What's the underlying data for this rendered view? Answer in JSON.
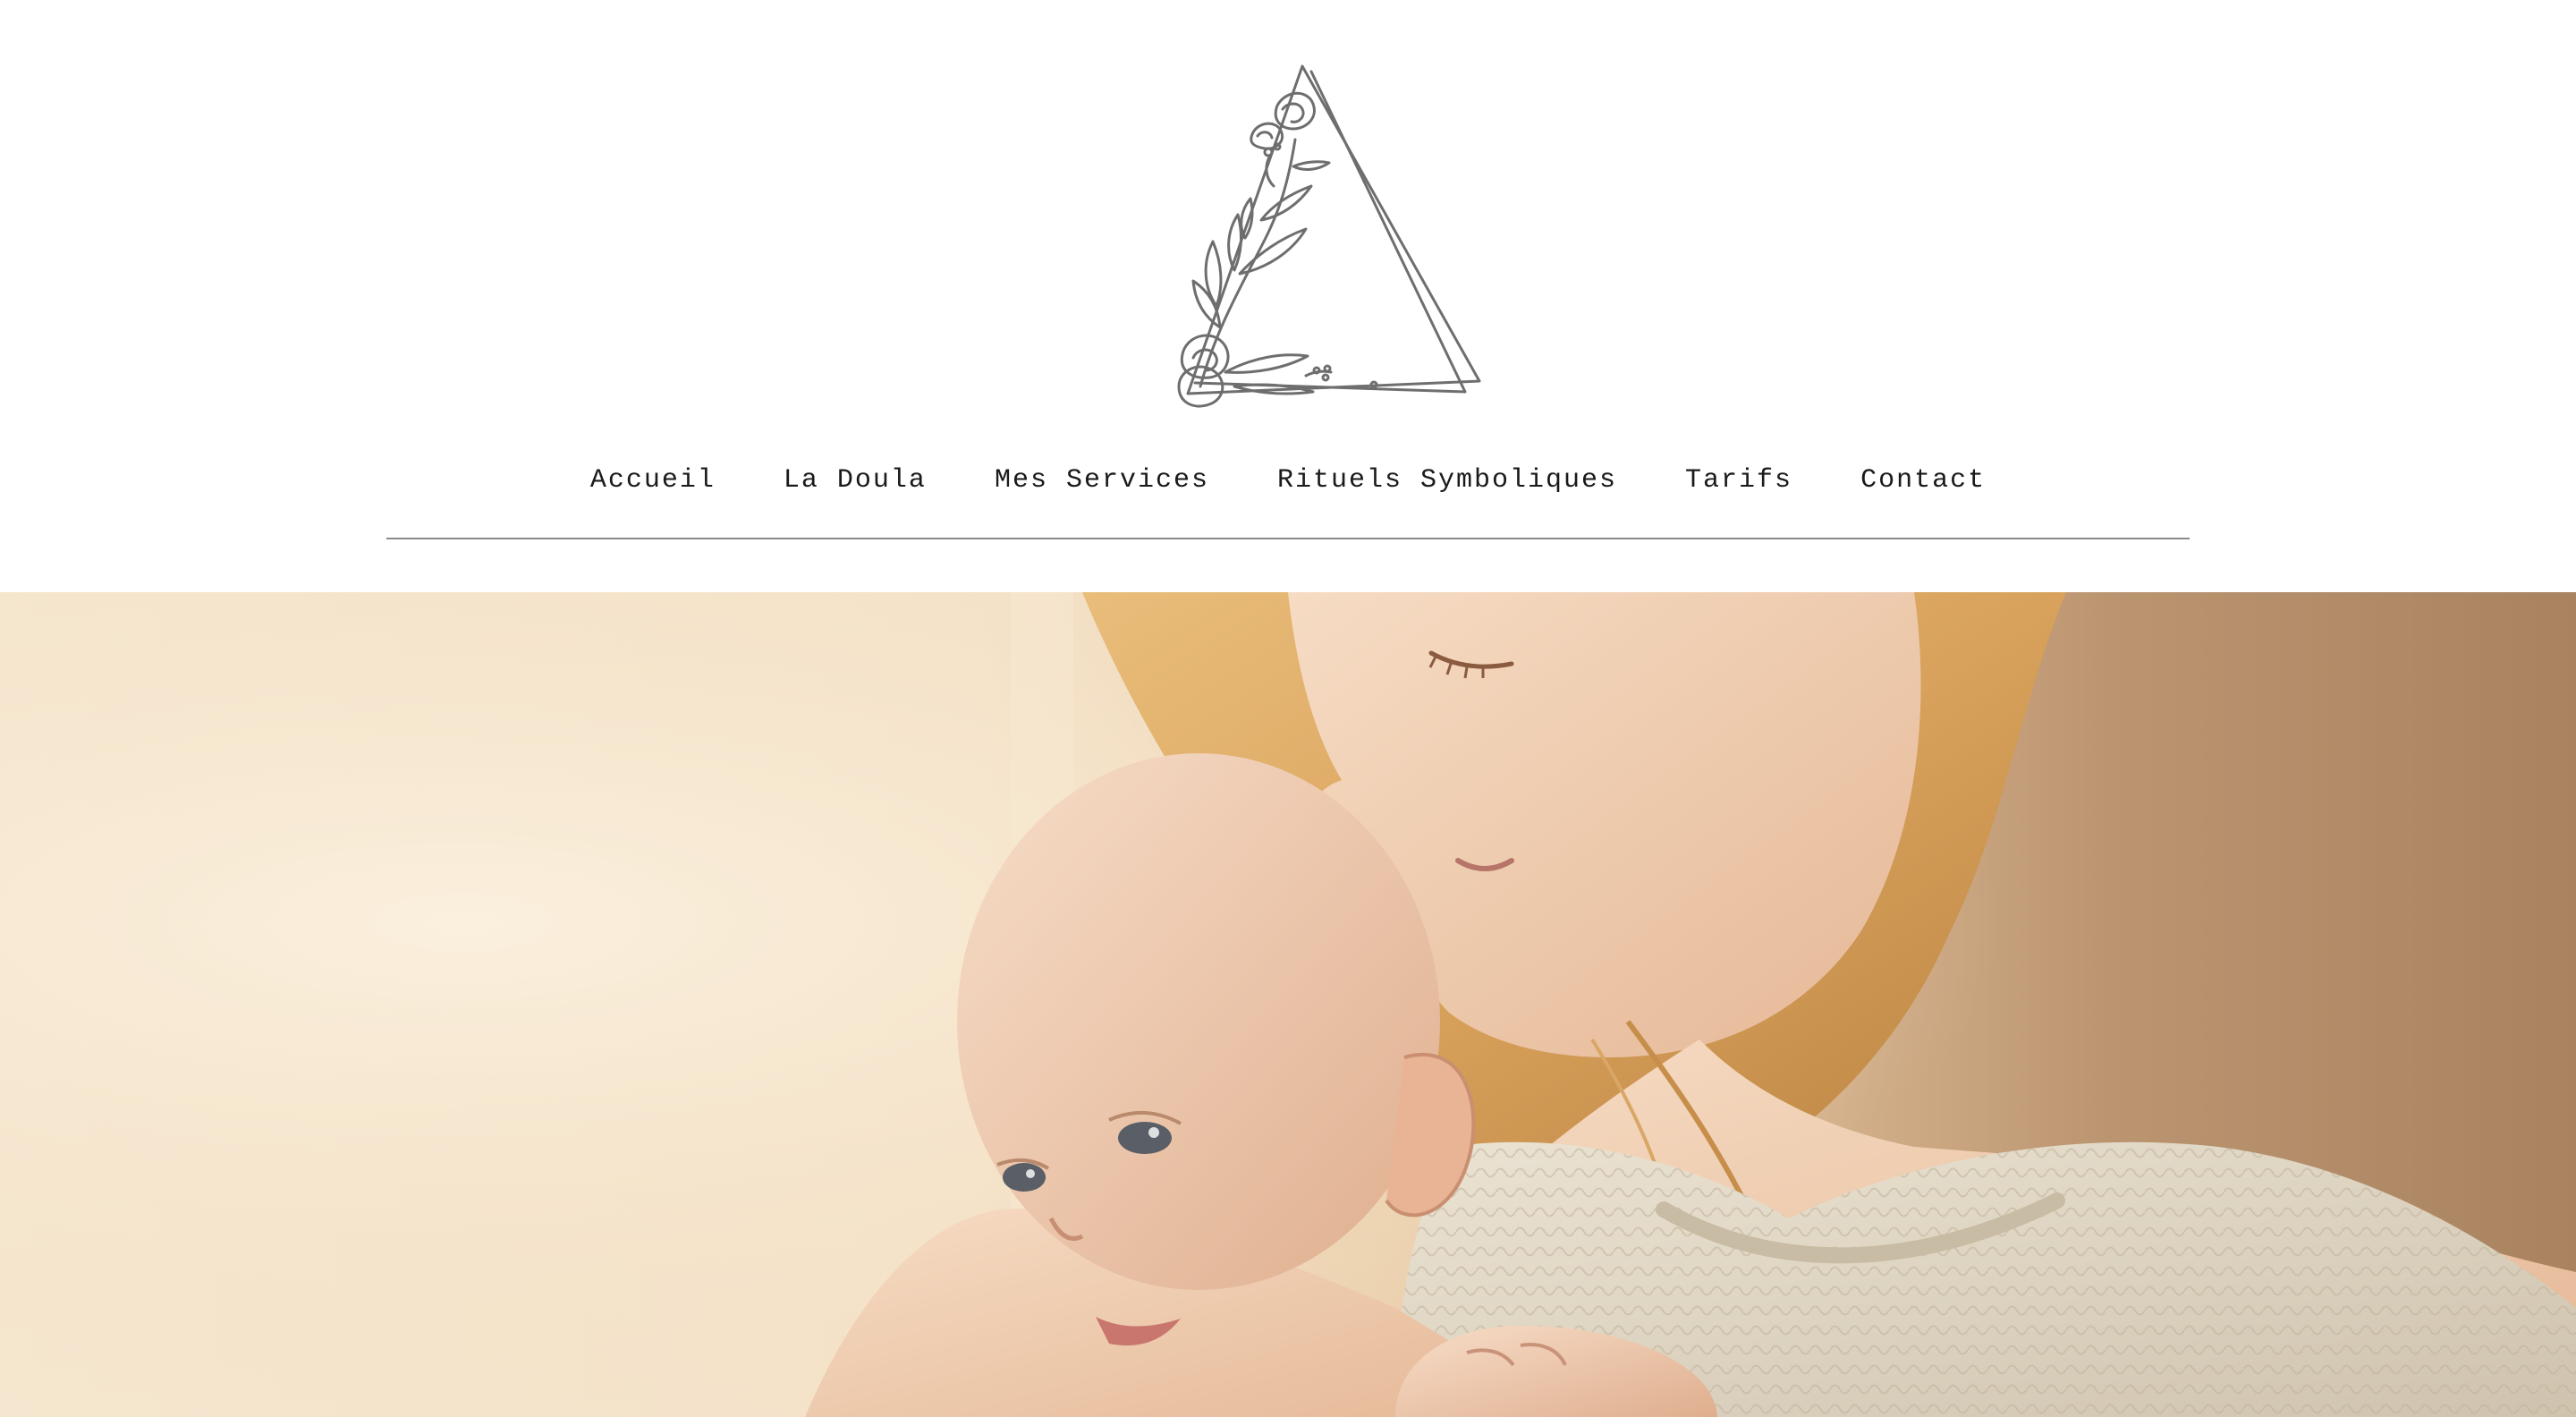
{
  "header": {
    "logo_icon": "floral-triangle-logo-icon",
    "accent_color": "#6e6e6e"
  },
  "nav": {
    "items": [
      {
        "label": "Accueil"
      },
      {
        "label": "La Doula"
      },
      {
        "label": "Mes Services"
      },
      {
        "label": "Rituels Symboliques"
      },
      {
        "label": "Tarifs"
      },
      {
        "label": "Contact"
      }
    ]
  },
  "hero": {
    "image_icon": "mother-and-baby-photo"
  }
}
